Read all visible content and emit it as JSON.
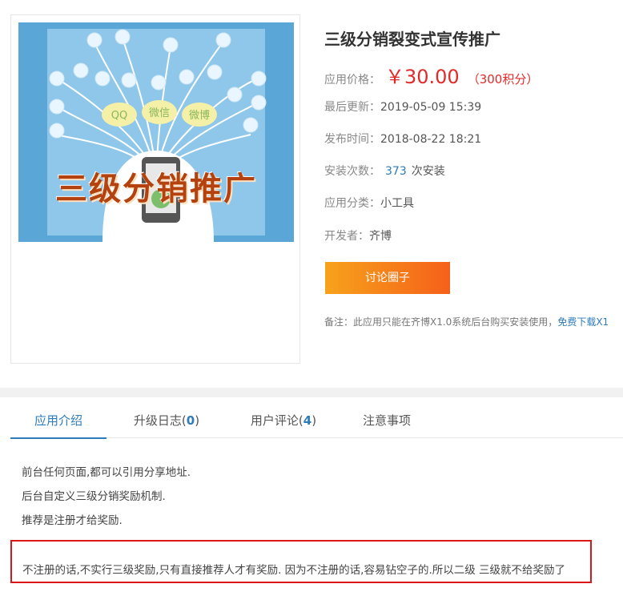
{
  "app": {
    "title": "三级分销裂变式宣传推广",
    "banner_text": "三级分销推广",
    "bubbles": [
      "QQ",
      "微信",
      "微博"
    ],
    "price_label": "应用价格：",
    "price_value": "￥30.00",
    "price_points": "（300积分）",
    "updated_label": "最后更新：",
    "updated_value": "2019-05-09 15:39",
    "published_label": "发布时间：",
    "published_value": "2018-08-22 18:21",
    "installs_label": "安装次数：",
    "installs_count": "373",
    "installs_suffix": "次安装",
    "category_label": "应用分类：",
    "category_value": "小工具",
    "developer_label": "开发者：",
    "developer_value": "齐博",
    "discuss_button": "讨论圈子",
    "note_text": "备注：此应用只能在齐博X1.0系统后台购买安装使用，",
    "note_link": "免费下载X1"
  },
  "tabs": [
    {
      "label": "应用介绍"
    },
    {
      "label": "升级日志(",
      "count": "0",
      "suffix": ")"
    },
    {
      "label": "用户评论(",
      "count": "4",
      "suffix": ")"
    },
    {
      "label": "注意事项"
    }
  ],
  "intro": {
    "lines": [
      "前台任何页面,都可以引用分享地址.",
      "后台自定义三级分销奖励机制.",
      "推荐是注册才给奖励."
    ],
    "highlight": "不注册的话,不实行三级奖励,只有直接推荐人才有奖励. 因为不注册的话,容易钻空子的.所以二级 三级就不给奖励了"
  },
  "colors": {
    "accent": "#2b7bbd",
    "price": "#e32a2a",
    "button_start": "#f7a21b",
    "button_end": "#f5601a",
    "highlight_border": "#d9161a"
  }
}
